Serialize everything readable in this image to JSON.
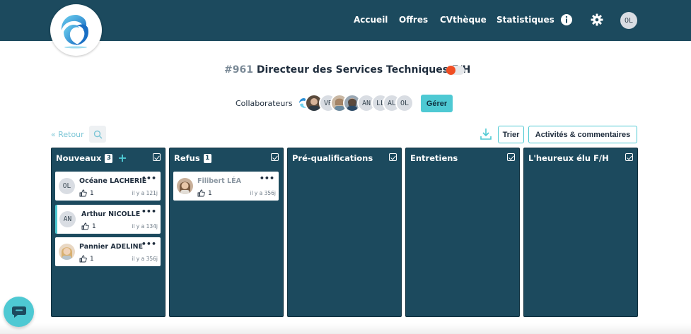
{
  "nav": {
    "home": "Accueil",
    "offers": "Offres",
    "cvtheque": "CVthèque",
    "stats": "Statistiques",
    "user_initials": "OL"
  },
  "job": {
    "number": "#961",
    "title": "Directeur des Services Techniques F/H",
    "status_color": "#f04e23"
  },
  "collaborators": {
    "label": "Collaborateurs",
    "avatars": [
      "",
      "",
      "VR",
      "",
      "",
      "AN",
      "LL",
      "AL",
      "OL"
    ],
    "manage_label": "Gérer"
  },
  "toolbar": {
    "back_label": "« Retour",
    "sort_label": "Trier",
    "activity_label": "Activités & commentaires"
  },
  "columns": [
    {
      "title": "Nouveaux",
      "count": "3",
      "cards": [
        {
          "initials": "OL",
          "name": "Océane LACHERIE",
          "likes": "1",
          "time": "il y a 121j"
        },
        {
          "initials": "AN",
          "name": "Arthur NICOLLE",
          "likes": "1",
          "time": "il y a 134j"
        },
        {
          "initials": "",
          "name": "Pannier ADELINE",
          "likes": "1",
          "time": "il y a 356j"
        }
      ]
    },
    {
      "title": "Refus",
      "count": "1",
      "cards": [
        {
          "initials": "",
          "name": "Filibert LÉA",
          "likes": "1",
          "time": "il y a 356j"
        }
      ]
    },
    {
      "title": "Pré-qualifications"
    },
    {
      "title": "Entretiens"
    },
    {
      "title": "L'heureux élu F/H"
    }
  ],
  "colors": {
    "primary": "#1c4a5e",
    "accent": "#4ec9d3"
  }
}
